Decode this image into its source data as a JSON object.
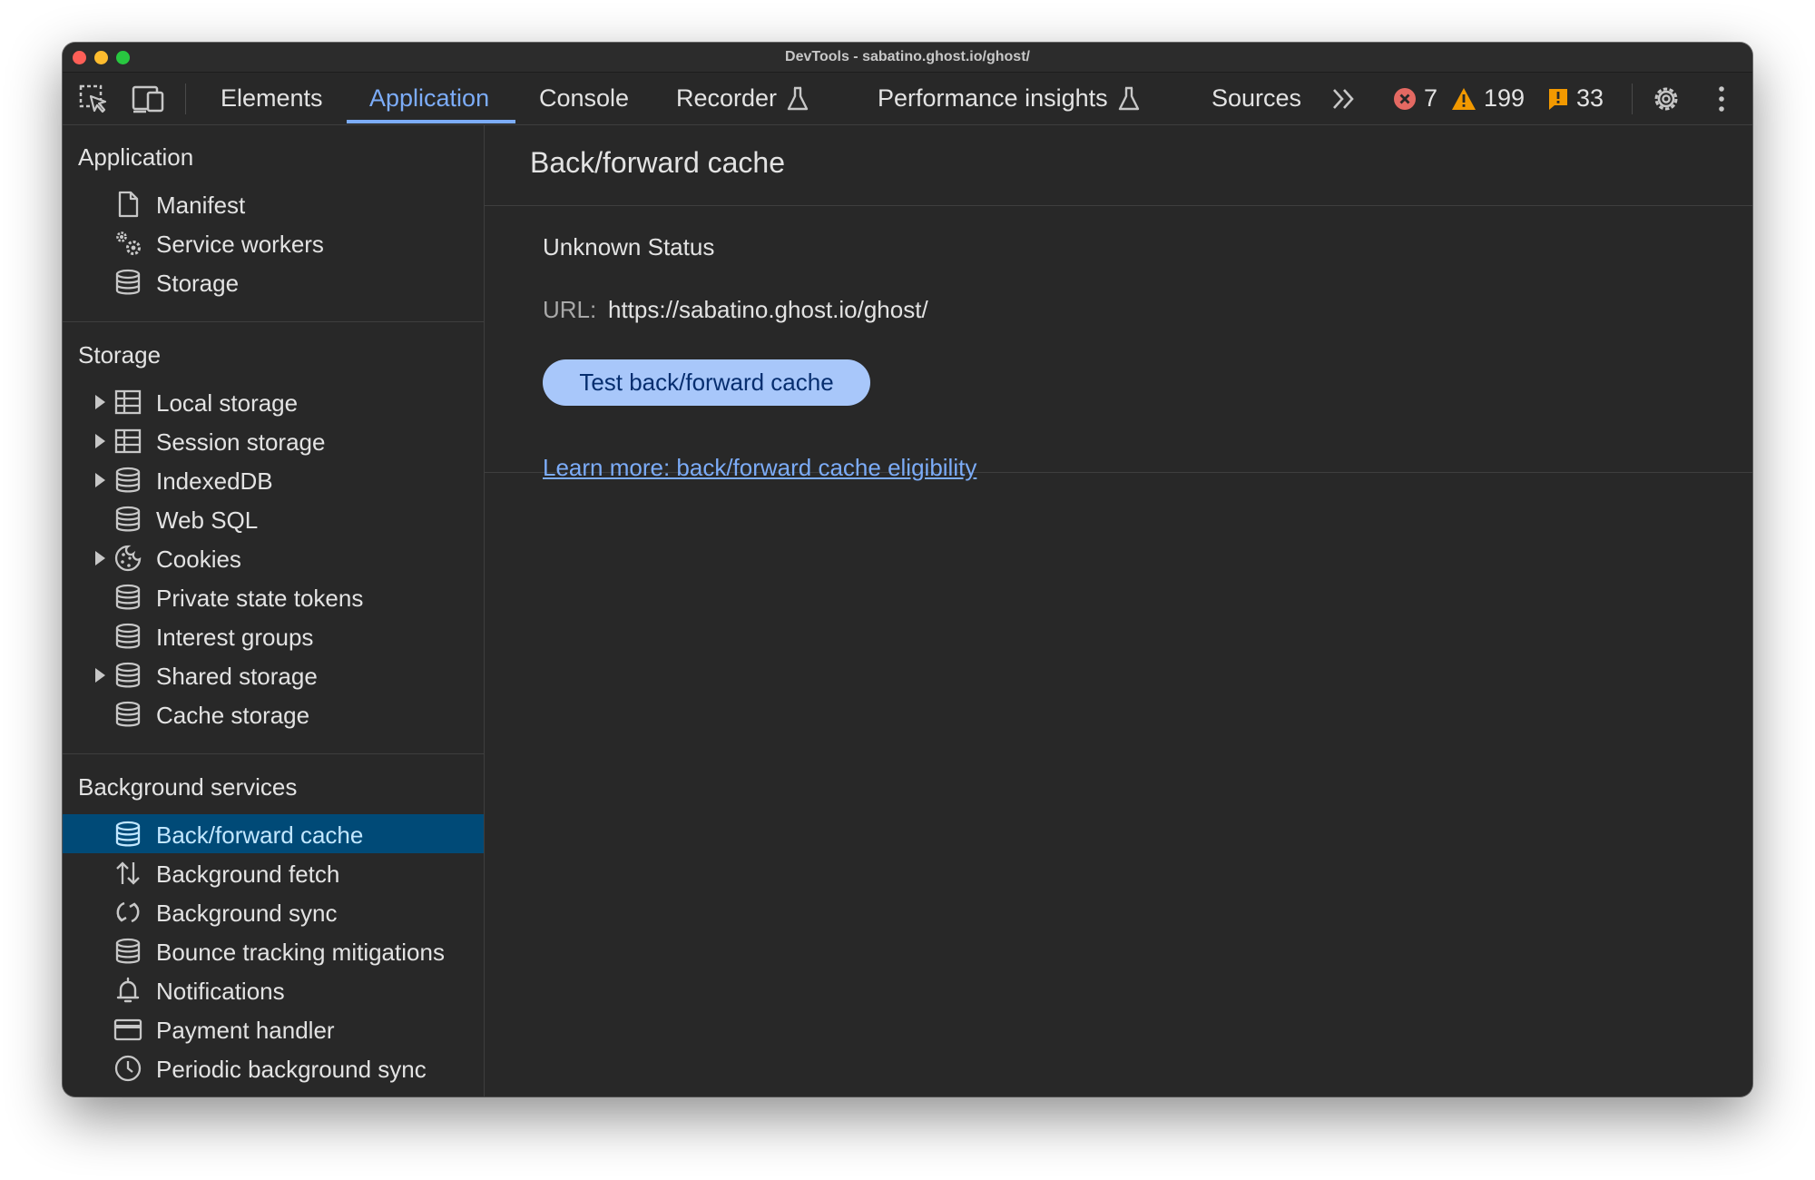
{
  "window": {
    "title": "DevTools - sabatino.ghost.io/ghost/"
  },
  "toolbar": {
    "tabs": [
      {
        "label": "Elements"
      },
      {
        "label": "Application"
      },
      {
        "label": "Console"
      },
      {
        "label": "Recorder"
      },
      {
        "label": "Performance insights"
      },
      {
        "label": "Sources"
      }
    ],
    "active_tab": "Application",
    "errors_count": "7",
    "warnings_count": "199",
    "issues_count": "33",
    "icons": [
      "inspect-element-icon",
      "device-toolbar-icon",
      "flask-icon",
      "more-tabs-icon",
      "error-icon",
      "warning-icon",
      "issue-icon",
      "gear-icon",
      "kebab-menu-icon"
    ]
  },
  "sidebar": {
    "application": {
      "title": "Application",
      "items": [
        {
          "label": "Manifest",
          "icon": "file-icon"
        },
        {
          "label": "Service workers",
          "icon": "gears-icon"
        },
        {
          "label": "Storage",
          "icon": "database-icon"
        }
      ]
    },
    "storage": {
      "title": "Storage",
      "items": [
        {
          "label": "Local storage",
          "icon": "table-icon",
          "expandable": true
        },
        {
          "label": "Session storage",
          "icon": "table-icon",
          "expandable": true
        },
        {
          "label": "IndexedDB",
          "icon": "database-icon",
          "expandable": true
        },
        {
          "label": "Web SQL",
          "icon": "database-icon"
        },
        {
          "label": "Cookies",
          "icon": "cookie-icon",
          "expandable": true
        },
        {
          "label": "Private state tokens",
          "icon": "database-icon"
        },
        {
          "label": "Interest groups",
          "icon": "database-icon"
        },
        {
          "label": "Shared storage",
          "icon": "database-icon",
          "expandable": true
        },
        {
          "label": "Cache storage",
          "icon": "database-icon"
        }
      ]
    },
    "background": {
      "title": "Background services",
      "items": [
        {
          "label": "Back/forward cache",
          "icon": "database-icon",
          "selected": true
        },
        {
          "label": "Background fetch",
          "icon": "up-down-arrows-icon"
        },
        {
          "label": "Background sync",
          "icon": "sync-icon"
        },
        {
          "label": "Bounce tracking mitigations",
          "icon": "database-icon"
        },
        {
          "label": "Notifications",
          "icon": "bell-icon"
        },
        {
          "label": "Payment handler",
          "icon": "credit-card-icon"
        },
        {
          "label": "Periodic background sync",
          "icon": "clock-icon"
        }
      ]
    }
  },
  "main": {
    "title": "Back/forward cache",
    "status": "Unknown Status",
    "url_label": "URL:",
    "url_value": "https://sabatino.ghost.io/ghost/",
    "test_button": "Test back/forward cache",
    "learn_more": "Learn more: back/forward cache eligibility"
  },
  "colors": {
    "background": "#282828",
    "accent": "#7cacf8",
    "selected_row": "#004a77",
    "button": "#a8c7fa",
    "error": "#e46962",
    "warning": "#f29900"
  }
}
